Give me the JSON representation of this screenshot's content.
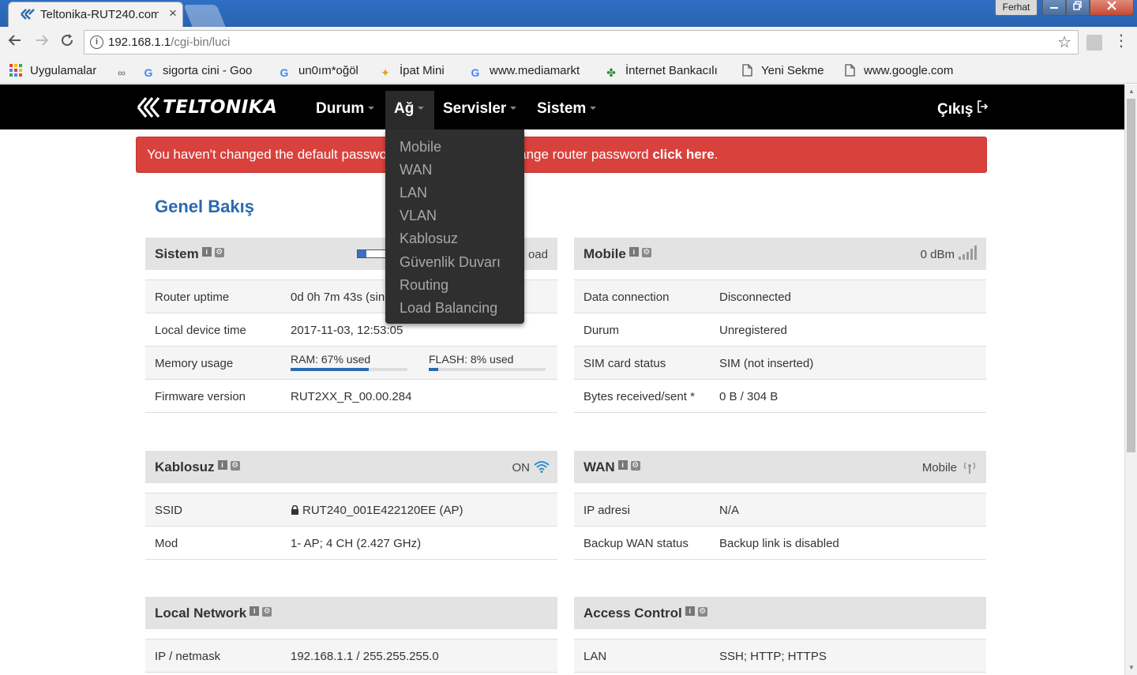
{
  "browser": {
    "tab_title": "Teltonika-RUT240.com",
    "close_glyph": "×",
    "profile_name": "Ferhat",
    "url_host": "192.168.1.1",
    "url_path": "/cgi-bin/luci",
    "bookmarks": [
      {
        "label": "Uygulamalar",
        "icon": "apps-grid-icon"
      },
      {
        "label": "",
        "icon": "link-icon"
      },
      {
        "label": "sigorta cini - Goo",
        "icon": "google-icon"
      },
      {
        "label": "un0ım*oğöl",
        "icon": "google-icon"
      },
      {
        "label": "İpat Mini",
        "icon": "ipat-icon"
      },
      {
        "label": "www.mediamarkt",
        "icon": "google-icon"
      },
      {
        "label": "İnternet Bankacılı",
        "icon": "clover-icon"
      },
      {
        "label": "Yeni Sekme",
        "icon": "page-icon"
      },
      {
        "label": "www.google.com",
        "icon": "page-icon"
      }
    ]
  },
  "router": {
    "brand": "TELTONIKA",
    "nav": {
      "durum": "Durum",
      "ag": "Ağ",
      "servisler": "Servisler",
      "sistem": "Sistem",
      "logout": "Çıkış"
    },
    "alert": {
      "text_left": "You haven't changed the default passwo",
      "text_right": "ange router password",
      "link": "click here",
      "tail": "."
    },
    "page_title": "Genel Bakış",
    "dropdown_items": [
      "Mobile",
      "WAN",
      "LAN",
      "VLAN",
      "Kablosuz",
      "Güvenlik Duvarı",
      "Routing",
      "Load Balancing"
    ],
    "panels": {
      "sistem": {
        "title": "Sistem",
        "status": "oad",
        "cpu_load_percent": 30,
        "rows": [
          {
            "k": "Router uptime",
            "v": "0d 0h 7m 43s (sinc"
          },
          {
            "k": "Local device time",
            "v": "2017-11-03, 12:53:05"
          },
          {
            "k": "Memory usage",
            "v": ""
          },
          {
            "k": "Firmware version",
            "v": "RUT2XX_R_00.00.284"
          }
        ],
        "ram_label": "RAM: 67% used",
        "ram_percent": 67,
        "flash_label": "FLASH: 8% used",
        "flash_percent": 8
      },
      "mobile": {
        "title": "Mobile",
        "status": "0 dBm",
        "rows": [
          {
            "k": "Data connection",
            "v": "Disconnected"
          },
          {
            "k": "Durum",
            "v": "Unregistered"
          },
          {
            "k": "SIM card status",
            "v": "SIM (not inserted)"
          },
          {
            "k": "Bytes received/sent *",
            "v": "0 B / 304 B"
          }
        ]
      },
      "kablosuz": {
        "title": "Kablosuz",
        "status": "ON",
        "rows": [
          {
            "k": "SSID",
            "v": "RUT240_001E422120EE (AP)"
          },
          {
            "k": "Mod",
            "v": "1- AP; 4 CH (2.427 GHz)"
          }
        ]
      },
      "wan": {
        "title": "WAN",
        "status": "Mobile",
        "rows": [
          {
            "k": "IP adresi",
            "v": "N/A"
          },
          {
            "k": "Backup WAN status",
            "v": "Backup link is disabled"
          }
        ]
      },
      "local_network": {
        "title": "Local Network",
        "rows": [
          {
            "k": "IP / netmask",
            "v": "192.168.1.1 / 255.255.255.0"
          }
        ]
      },
      "access_control": {
        "title": "Access Control",
        "rows": [
          {
            "k": "LAN",
            "v": "SSH; HTTP; HTTPS"
          }
        ]
      }
    }
  },
  "colors": {
    "accent": "#2a6ab0",
    "alert_bg": "#d9413d",
    "navbar_bg": "#000000",
    "wifi_icon": "#2a8ed8"
  }
}
